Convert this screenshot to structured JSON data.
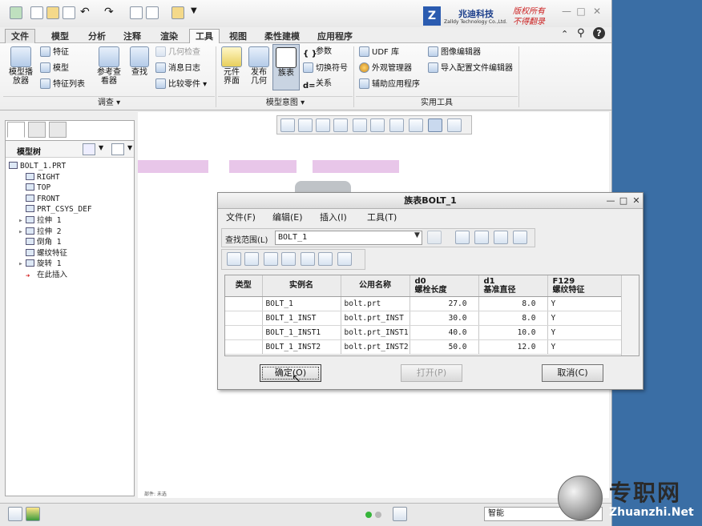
{
  "branding": {
    "logo_letter": "Z",
    "company_cn": "兆迪科技",
    "company_en": "Zalldy Technology Co.,Ltd.",
    "slogan_line1": "版权所有",
    "slogan_line2": "不得翻录"
  },
  "tabs": [
    "文件",
    "模型",
    "分析",
    "注释",
    "渲染",
    "工具",
    "视图",
    "柔性建模",
    "应用程序"
  ],
  "active_tab": "工具",
  "ribbon": {
    "investigate": {
      "model_player": "模型播\n放器",
      "feature": "特征",
      "model": "模型",
      "feature_list": "特征列表",
      "ref_viewer": "参考查\n看器",
      "find": "查找",
      "geom_check": "几何检查",
      "message_log": "消息日志",
      "compare_part": "比较零件",
      "group_label": "调查"
    },
    "model_intent": {
      "component_interface": "元件\n界面",
      "publish_geom": "发布\n几何",
      "family_table": "族表",
      "params": "参数",
      "switch_symbols": "切换符号",
      "relations": "关系",
      "group_label": "模型意图"
    },
    "utilities": {
      "udf_lib": "UDF 库",
      "appearance_mgr": "外观管理器",
      "aux_apps": "辅助应用程序",
      "image_editor": "图像编辑器",
      "import_config": "导入配置文件编辑器",
      "group_label": "实用工具"
    }
  },
  "sidebar": {
    "header": "模型树",
    "tree": [
      {
        "label": "BOLT_1.PRT",
        "indent": 0,
        "expand": ""
      },
      {
        "label": "RIGHT",
        "indent": 1,
        "expand": ""
      },
      {
        "label": "TOP",
        "indent": 1,
        "expand": ""
      },
      {
        "label": "FRONT",
        "indent": 1,
        "expand": ""
      },
      {
        "label": "PRT_CSYS_DEF",
        "indent": 1,
        "expand": ""
      },
      {
        "label": "拉伸 1",
        "indent": 1,
        "expand": "▸"
      },
      {
        "label": "拉伸 2",
        "indent": 1,
        "expand": "▸"
      },
      {
        "label": "倒角 1",
        "indent": 1,
        "expand": ""
      },
      {
        "label": "螺纹特征",
        "indent": 1,
        "expand": ""
      },
      {
        "label": "旋转 1",
        "indent": 1,
        "expand": "▸"
      },
      {
        "label": "在此插入",
        "indent": 1,
        "expand": ""
      }
    ]
  },
  "status": {
    "smart": "智能",
    "tiny": "部件: 未选"
  },
  "dialog": {
    "title": "族表BOLT_1",
    "menu": [
      "文件(F)",
      "编辑(E)",
      "插入(I)",
      "工具(T)"
    ],
    "scope_label": "查找范围(L)",
    "scope_value": "BOLT_1",
    "columns": [
      {
        "l1": "类型",
        "l2": ""
      },
      {
        "l1": "实例名",
        "l2": ""
      },
      {
        "l1": "公用名称",
        "l2": ""
      },
      {
        "l1": "d0",
        "l2": "螺栓长度"
      },
      {
        "l1": "d1",
        "l2": "基准直径"
      },
      {
        "l1": "F129",
        "l2": "螺纹特征"
      }
    ],
    "rows": [
      [
        "",
        "BOLT_1",
        "bolt.prt",
        "27.0",
        "8.0",
        "Y"
      ],
      [
        "",
        "BOLT_1_INST",
        "bolt.prt_INST",
        "30.0",
        "8.0",
        "Y"
      ],
      [
        "",
        "BOLT_1_INST1",
        "bolt.prt_INST1",
        "40.0",
        "10.0",
        "Y"
      ],
      [
        "",
        "BOLT_1_INST2",
        "bolt.prt_INST2",
        "50.0",
        "12.0",
        "Y"
      ]
    ],
    "ok": "确定(O)",
    "open": "打开(P)",
    "cancel": "取消(C)"
  },
  "watermark": {
    "cn": "专职网",
    "en": "Zhuanzhi.Net"
  }
}
